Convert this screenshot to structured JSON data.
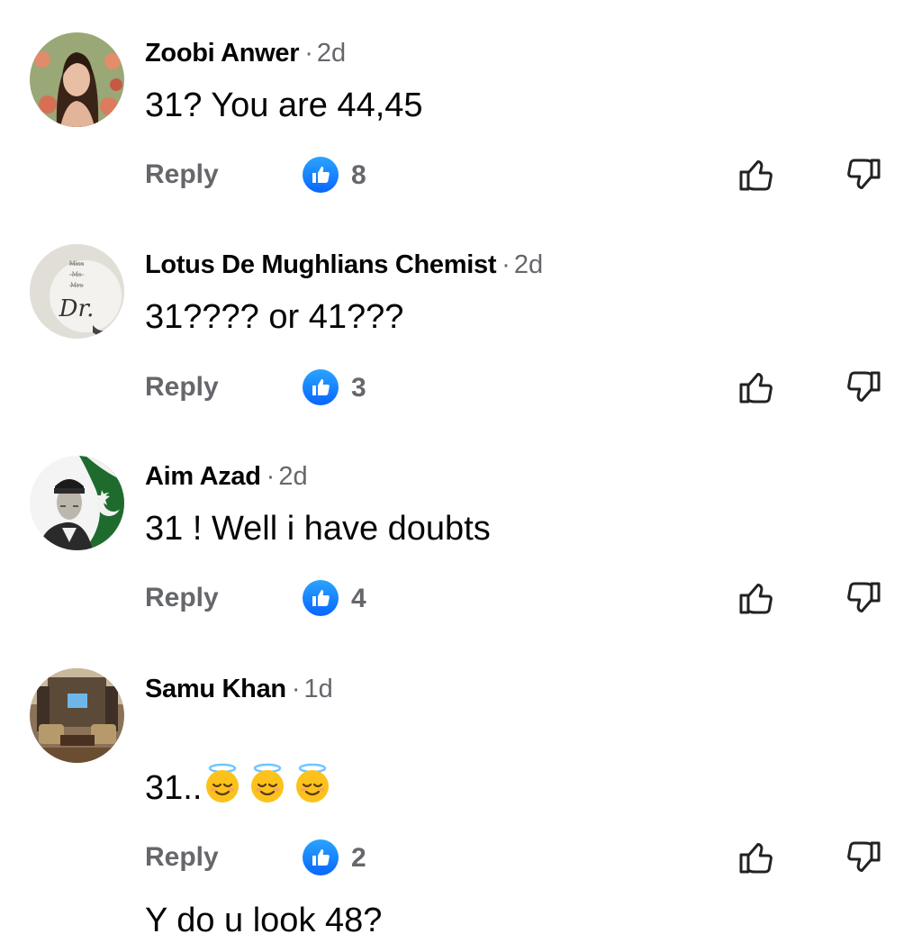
{
  "comments": [
    {
      "author": "Zoobi Anwer",
      "separator": "·",
      "time": "2d",
      "text": "31? You are 44,45",
      "reply_label": "Reply",
      "like_count": "8"
    },
    {
      "author": "Lotus De Mughlians Chemist",
      "separator": "·",
      "time": "2d",
      "text": "31???? or 41???",
      "reply_label": "Reply",
      "like_count": "3",
      "avatar_text": [
        "Miss",
        "Ms",
        "Mrs",
        "Dr."
      ]
    },
    {
      "author": "Aim Azad",
      "separator": "·",
      "time": "2d",
      "text": "31 ! Well i have doubts",
      "reply_label": "Reply",
      "like_count": "4"
    },
    {
      "author": "Samu Khan",
      "separator": "·",
      "time": "1d",
      "text_line1": "31..",
      "emoji": [
        "smiling-face-with-halo",
        "smiling-face-with-halo",
        "smiling-face-with-halo"
      ],
      "text_line2": "Y do u look 48?",
      "reply_label": "Reply",
      "like_count": "2"
    }
  ],
  "colors": {
    "secondary_text": "#65676b",
    "primary_text": "#050505",
    "like_blue": "#0866ff"
  }
}
